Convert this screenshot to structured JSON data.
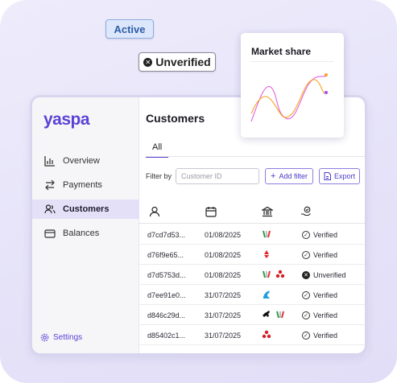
{
  "badges": {
    "active": "Active",
    "unverified": "Unverified"
  },
  "sidebar": {
    "logo": "yaspa",
    "items": [
      {
        "label": "Overview",
        "icon": "bar-chart-icon"
      },
      {
        "label": "Payments",
        "icon": "arrows-swap-icon"
      },
      {
        "label": "Customers",
        "icon": "users-icon",
        "active": true
      },
      {
        "label": "Balances",
        "icon": "wallet-icon"
      }
    ],
    "settings": "Settings"
  },
  "main": {
    "title": "Customers",
    "tabs": [
      {
        "label": "All",
        "active": true
      }
    ],
    "filter_label": "Filter by",
    "search_placeholder": "Customer ID",
    "add_filter": "Add filter",
    "export": "Export",
    "columns": [
      "user-icon",
      "calendar-icon",
      "bank-icon",
      "hand-check-icon"
    ],
    "rows": [
      {
        "id": "d7cd7d53...",
        "date": "01/08/2025",
        "banks": [
          "green-red-bank-logo"
        ],
        "status": "Verified"
      },
      {
        "id": "d76f9e65...",
        "date": "01/08/2025",
        "banks": [
          "red-bank-logo"
        ],
        "status": "Verified"
      },
      {
        "id": "d7d5753d...",
        "date": "01/08/2025",
        "banks": [
          "green-red-bank-logo",
          "red-cluster-bank-logo"
        ],
        "status": "Unverified"
      },
      {
        "id": "d7ee91e0...",
        "date": "31/07/2025",
        "banks": [
          "blue-bank-logo"
        ],
        "status": "Verified"
      },
      {
        "id": "d846c29d...",
        "date": "31/07/2025",
        "banks": [
          "black-horse-bank-logo",
          "green-red-bank-logo"
        ],
        "status": "Verified"
      },
      {
        "id": "d85402c1...",
        "date": "31/07/2025",
        "banks": [
          "red-cluster-bank-logo"
        ],
        "status": "Verified"
      }
    ]
  },
  "popup": {
    "title": "Market share",
    "series_colors": [
      "#e45fe0",
      "#f5a623",
      "#a34cf0"
    ]
  },
  "colors": {
    "accent": "#5b42d6",
    "active_badge_bg": "#dde7fb",
    "background": "#e6e3f9"
  }
}
